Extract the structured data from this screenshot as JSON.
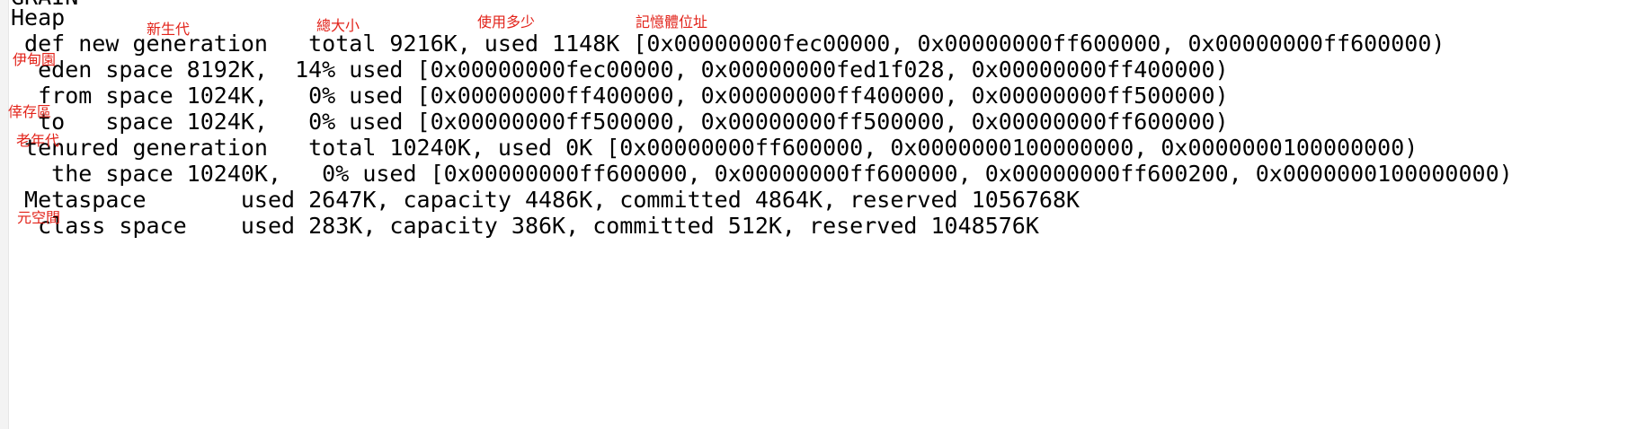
{
  "log": {
    "top_cut_fragment": "GRAIN",
    "lines": [
      "Heap",
      " def new generation   total 9216K, used 1148K [0x00000000fec00000, 0x00000000ff600000, 0x00000000ff600000)",
      "  eden space 8192K,  14% used [0x00000000fec00000, 0x00000000fed1f028, 0x00000000ff400000)",
      "  from space 1024K,   0% used [0x00000000ff400000, 0x00000000ff400000, 0x00000000ff500000)",
      "  to   space 1024K,   0% used [0x00000000ff500000, 0x00000000ff500000, 0x00000000ff600000)",
      " tenured generation   total 10240K, used 0K [0x00000000ff600000, 0x0000000100000000, 0x0000000100000000)",
      "   the space 10240K,   0% used [0x00000000ff600000, 0x00000000ff600000, 0x00000000ff600200, 0x0000000100000000)",
      " Metaspace       used 2647K, capacity 4486K, committed 4864K, reserved 1056768K",
      "  class space    used 283K, capacity 386K, committed 512K, reserved 1048576K"
    ]
  },
  "annotations": {
    "young_generation": "新生代",
    "total_size": "總大小",
    "used_amount": "使用多少",
    "memory_address": "記憶體位址",
    "eden": "伊甸園",
    "survivor": "倖存區",
    "old_generation": "老年代",
    "metaspace": "元空間"
  },
  "colors": {
    "annotation": "#e2231a",
    "text": "#000000",
    "background": "#ffffff"
  }
}
